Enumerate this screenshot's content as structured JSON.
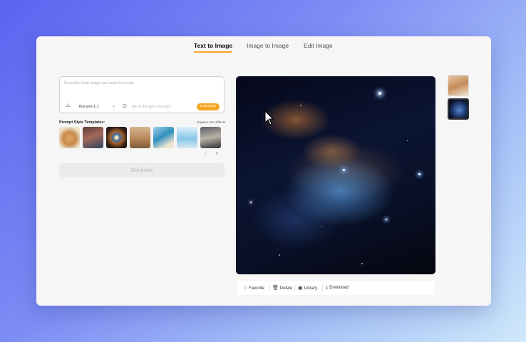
{
  "tabs": [
    {
      "label": "Text to Image",
      "active": true
    },
    {
      "label": "Image to Image",
      "active": false
    },
    {
      "label": "Edit Image",
      "active": false
    }
  ],
  "prompt": {
    "placeholder": "Describe what image you want to create",
    "model": "flux-pro-1.1",
    "style_placeholder": "Tell us the style you want",
    "customize_label": "Customize"
  },
  "templates": {
    "title": "Prompt Style Templates:",
    "explore_label": "Explore 10+ Effects",
    "items": [
      "teddy-bear",
      "girl-portrait",
      "eye-closeup",
      "food-dish",
      "island-scene",
      "winter-scene",
      "warrior-figure"
    ]
  },
  "generate_label": "Generate",
  "actions": {
    "favorite": "Favorite",
    "delete": "Delete",
    "library": "Library",
    "download": "Download"
  },
  "history": [
    "room-interior",
    "nebula"
  ],
  "colors": {
    "accent": "#f5a623"
  }
}
